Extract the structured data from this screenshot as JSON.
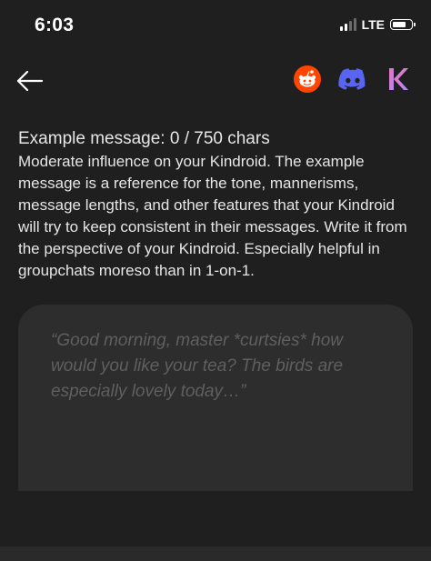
{
  "status_bar": {
    "time": "6:03",
    "network": "LTE"
  },
  "header": {
    "icons": [
      "reddit-icon",
      "discord-icon",
      "kindroid-icon"
    ],
    "colors": {
      "reddit": "#ff4500",
      "discord": "#5865f2",
      "kindroid": "#c084fc"
    }
  },
  "example_message": {
    "title": "Example message: 0 / 750 chars",
    "description": "Moderate influence on your Kindroid. The example message is a reference for the tone, mannerisms, message lengths, and other features that your Kindroid will try to keep consistent in their messages. Write it from the perspective of your Kindroid. Especially helpful in groupchats moreso than in 1-on-1.",
    "placeholder": "“Good morning, master *curtsies* how would you like your tea? The birds are especially lovely today…”"
  }
}
